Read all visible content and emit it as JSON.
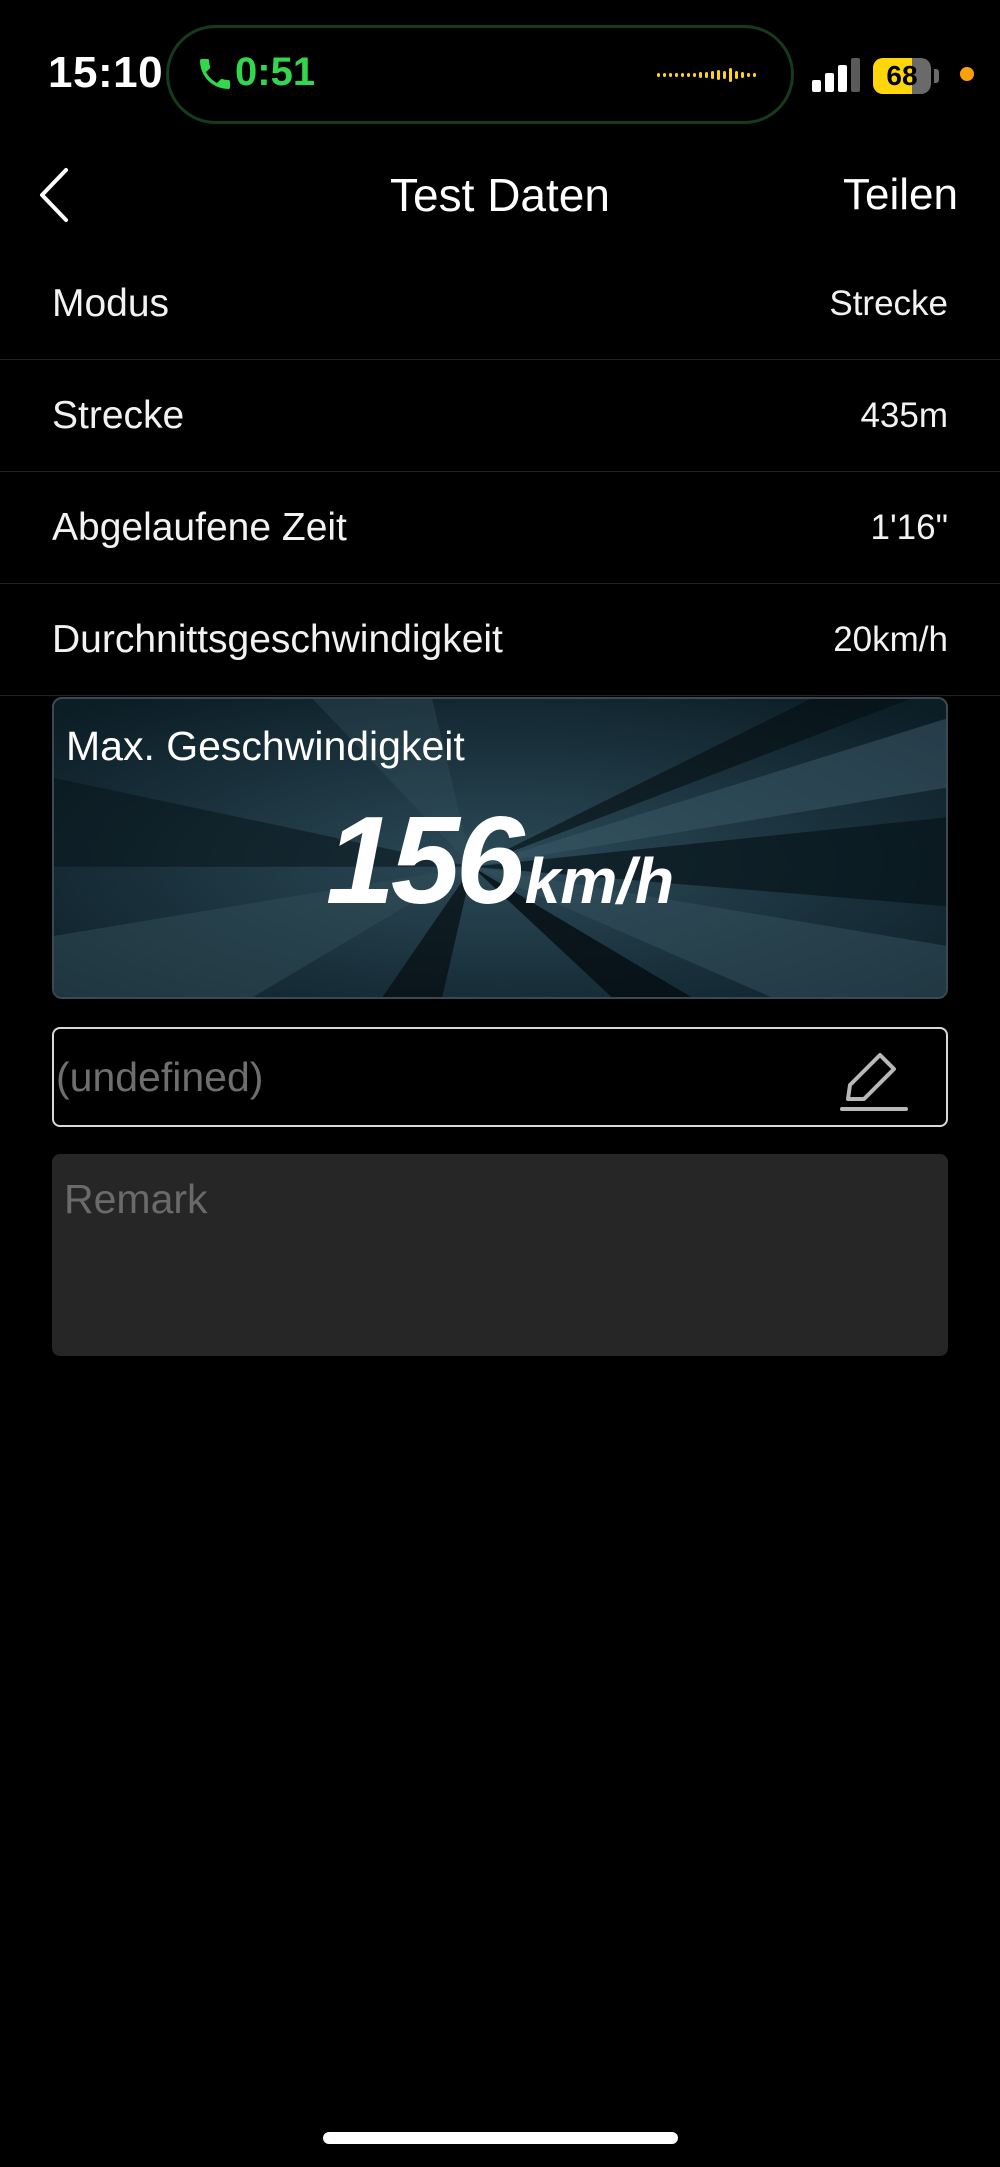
{
  "status_bar": {
    "time": "15:10",
    "call_duration": "0:51",
    "battery_level": "68",
    "battery_fraction": 0.68,
    "icons": {
      "call": "phone-icon",
      "audio": "audio-waveform-icon",
      "signal": "cellular-signal-icon",
      "battery": "battery-icon",
      "privacy": "privacy-indicator-dot"
    },
    "colors": {
      "call": "#32d74b",
      "waveform": "#ffd60a",
      "battery": "#ffd60a",
      "privacy_dot": "#ff9f0a"
    }
  },
  "nav": {
    "back_icon": "chevron-left-icon",
    "title": "Test Daten",
    "share_label": "Teilen"
  },
  "details": [
    {
      "label": "Modus",
      "value": "Strecke"
    },
    {
      "label": "Strecke",
      "value": "435m"
    },
    {
      "label": "Abgelaufene Zeit",
      "value": "1'16\""
    },
    {
      "label": "Durchnittsgeschwindigkeit",
      "value": "20km/h"
    }
  ],
  "max_speed": {
    "label": "Max. Geschwindigkeit",
    "value": "156",
    "unit": "km/h"
  },
  "name_field": {
    "placeholder": "(undefined)",
    "edit_icon": "pencil-edit-icon"
  },
  "remark": {
    "placeholder": "Remark"
  }
}
